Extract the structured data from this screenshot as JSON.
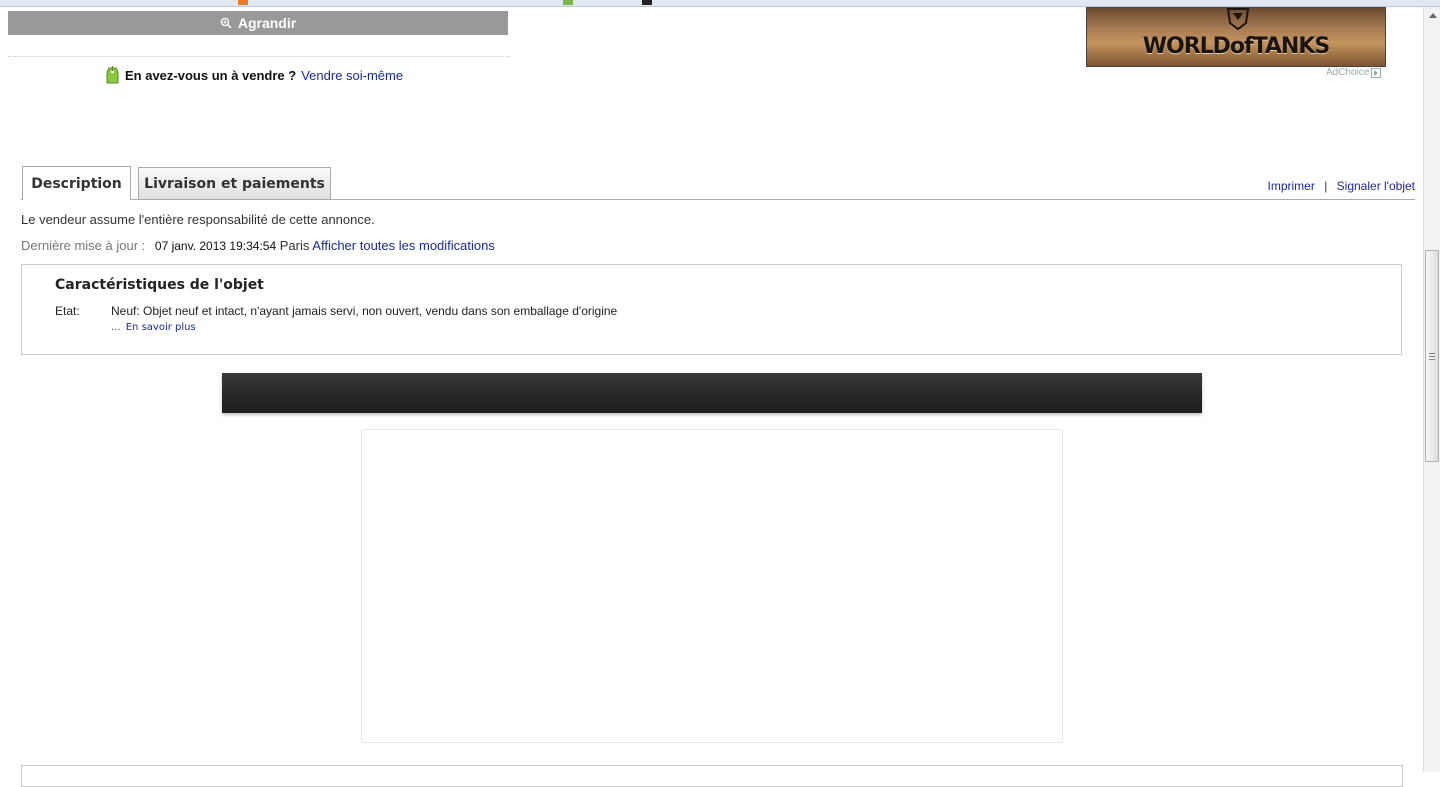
{
  "gallery": {
    "enlarge_label": "Agrandir"
  },
  "sell": {
    "question": "En avez-vous un à vendre ?",
    "link": "Vendre soi-même"
  },
  "ad": {
    "brand_text": "WORLDofTANKS",
    "adchoice_label": "AdChoice"
  },
  "tabs": [
    {
      "label": "Description",
      "active": true
    },
    {
      "label": "Livraison et paiements",
      "active": false
    }
  ],
  "actions": {
    "print": "Imprimer",
    "separator": "|",
    "report": "Signaler l'objet"
  },
  "description": {
    "responsibility": "Le vendeur assume l'entière responsabilité de cette annonce.",
    "last_update_label": "Dernière mise à jour :",
    "last_update_date": "07 janv. 2013 19:34:54",
    "last_update_tz": "Paris",
    "show_changes": "Afficher toutes les modifications"
  },
  "specs": {
    "title": "Caractéristiques de l'objet",
    "condition_label": "Etat:",
    "condition_value": "Neuf: Objet neuf et intact, n'ayant jamais servi, non ouvert, vendu dans son emballage d'origine",
    "more_prefix": "...",
    "more_link": "En savoir plus"
  },
  "colors": {
    "link": "#1a2a9a",
    "enlarge_bg": "#999999",
    "tab_border": "#aaaaaa",
    "dark_banner": "#2a2a2a"
  },
  "icons": {
    "enlarge": "zoom-icon",
    "sell": "price-tag-icon",
    "adchoice": "adchoice-icon",
    "scroll_up": "chevron-up-icon"
  }
}
